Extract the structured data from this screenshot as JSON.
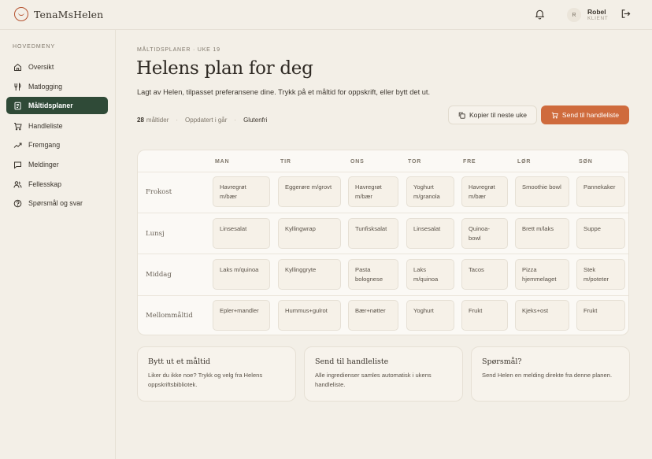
{
  "app": {
    "name": "TenaMsHelen"
  },
  "user": {
    "initial": "R",
    "name": "Robel",
    "role": "KLIENT"
  },
  "sidebar": {
    "heading": "HOVEDMENY",
    "items": [
      {
        "label": "Oversikt",
        "icon": "home-icon"
      },
      {
        "label": "Matlogging",
        "icon": "utensils-icon"
      },
      {
        "label": "Måltidsplaner",
        "icon": "notebook-icon",
        "active": true
      },
      {
        "label": "Handleliste",
        "icon": "cart-icon"
      },
      {
        "label": "Fremgang",
        "icon": "trend-icon"
      },
      {
        "label": "Meldinger",
        "icon": "message-icon"
      },
      {
        "label": "Fellesskap",
        "icon": "users-icon"
      },
      {
        "label": "Spørsmål og svar",
        "icon": "help-icon"
      }
    ]
  },
  "header": {
    "eyebrow": "MÅLTIDSPLANER · UKE 19",
    "title": "Helens plan for deg",
    "subtitle": "Lagt av Helen, tilpasset preferansene dine. Trykk på et måltid for oppskrift, eller bytt det ut.",
    "meals_count": "28",
    "meals_label": "måltider",
    "updated": "Oppdatert i går",
    "tag": "Glutenfri",
    "copy_button": "Kopier til neste uke",
    "send_button": "Send til handleliste"
  },
  "plan": {
    "days": [
      "MAN",
      "TIR",
      "ONS",
      "TOR",
      "FRE",
      "LØR",
      "SØN"
    ],
    "rows": [
      {
        "label": "Frokost",
        "meals": [
          "Havregrøt m/bær",
          "Eggerøre m/grovt",
          "Havregrøt m/bær",
          "Yoghurt m/granola",
          "Havregrøt m/bær",
          "Smoothie bowl",
          "Pannekaker"
        ]
      },
      {
        "label": "Lunsj",
        "meals": [
          "Linsesalat",
          "Kyllingwrap",
          "Tunfisksalat",
          "Linsesalat",
          "Quinoa-bowl",
          "Brett m/laks",
          "Suppe"
        ]
      },
      {
        "label": "Middag",
        "meals": [
          "Laks m/quinoa",
          "Kyllinggryte",
          "Pasta bolognese",
          "Laks m/quinoa",
          "Tacos",
          "Pizza hjemmelaget",
          "Stek m/poteter"
        ]
      },
      {
        "label": "Mellommåltid",
        "meals": [
          "Epler+mandler",
          "Hummus+gulrot",
          "Bær+nøtter",
          "Yoghurt",
          "Frukt",
          "Kjeks+ost",
          "Frukt"
        ]
      }
    ]
  },
  "cards": [
    {
      "title": "Bytt ut et måltid",
      "text": "Liker du ikke noe? Trykk og velg fra Helens oppskriftsbibliotek."
    },
    {
      "title": "Send til handleliste",
      "text": "Alle ingredienser samles automatisk i ukens handleliste."
    },
    {
      "title": "Spørsmål?",
      "text": "Send Helen en melding direkte fra denne planen."
    }
  ],
  "colors": {
    "accent": "#cf6b3d",
    "active_nav": "#2f4a37",
    "background": "#f3efe7"
  }
}
